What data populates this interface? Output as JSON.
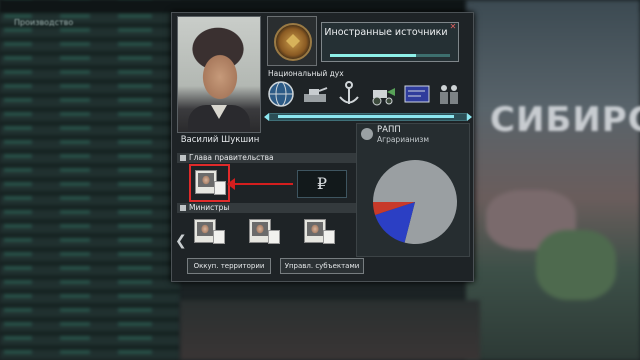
{
  "background": {
    "top_left_label": "Производство",
    "map_label": "СИБИРС"
  },
  "leader": {
    "name": "Василий Шукшин"
  },
  "decision": {
    "title": "Иностранные источники",
    "progress": 0.72
  },
  "national_spirit": {
    "title": "Национальный дух",
    "icons": [
      "globe-icon",
      "tank-factory-icon",
      "anchor-icon",
      "farm-tractor-icon",
      "blueprint-icon",
      "workers-icon"
    ]
  },
  "government": {
    "head_header": "Глава правительства",
    "ministers_header": "Министры",
    "logo_text": "₽"
  },
  "party": {
    "name": "РАПП",
    "ideology": "Аграрианизм",
    "popularity": [
      {
        "label": "grey",
        "value": 0.79,
        "color": "#9a9fa2"
      },
      {
        "label": "blue",
        "value": 0.16,
        "color": "#2b3fc4"
      },
      {
        "label": "red",
        "value": 0.05,
        "color": "#c83a2a"
      }
    ]
  },
  "buttons": {
    "occupied_territories": "Оккуп. территории",
    "manage_subjects": "Управл. субъектами"
  }
}
